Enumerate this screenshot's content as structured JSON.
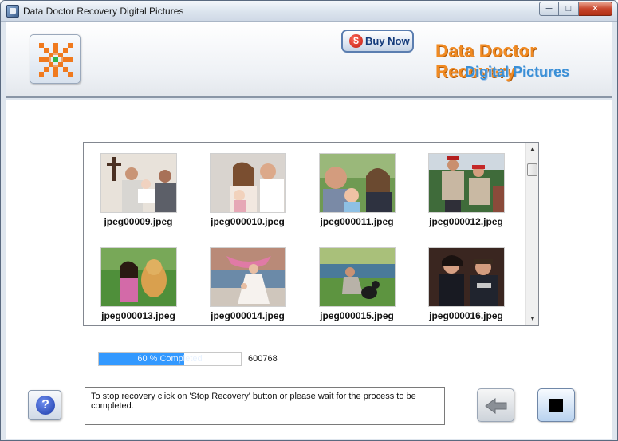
{
  "window": {
    "title": "Data Doctor Recovery Digital Pictures",
    "controls": {
      "minimize": "─",
      "maximize": "□",
      "close": "✕"
    }
  },
  "header": {
    "logo_icon": "orange-dots-logo-icon",
    "buy_now_label": "Buy Now",
    "buy_now_icon": "$",
    "brand_line1": "Data Doctor Recovery",
    "brand_line2": "Digital Pictures",
    "colors": {
      "brand_orange": "#f08a22",
      "brand_blue": "#3a8fd6"
    }
  },
  "gallery": {
    "items": [
      {
        "filename": "jpeg00009.jpeg"
      },
      {
        "filename": "jpeg000010.jpeg"
      },
      {
        "filename": "jpeg000011.jpeg"
      },
      {
        "filename": "jpeg000012.jpeg"
      },
      {
        "filename": "jpeg000013.jpeg"
      },
      {
        "filename": "jpeg000014.jpeg"
      },
      {
        "filename": "jpeg000015.jpeg"
      },
      {
        "filename": "jpeg000016.jpeg"
      }
    ],
    "scroll_up": "▲",
    "scroll_down": "▼"
  },
  "progress": {
    "percent": 60,
    "label": "60 % Completed",
    "count": "600768",
    "color": "#3399ff"
  },
  "footer": {
    "help_label": "?",
    "message": "To stop recovery click on 'Stop Recovery' button or please wait for the process to be completed."
  }
}
